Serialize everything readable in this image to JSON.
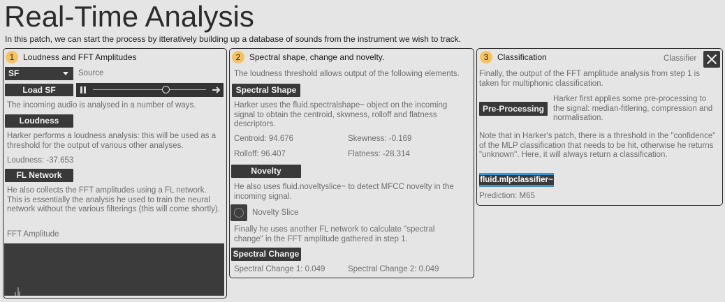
{
  "header": {
    "title": "Real-Time Analysis",
    "subtitle": "In this patch, we can start the process by itteratively building up a database of sounds from the instrument we wish to track."
  },
  "panel1": {
    "number": "1",
    "heading": "Loudness and FFT Amplitudes",
    "source_select": {
      "value": "SF",
      "label": "Source"
    },
    "load_button": "Load SF",
    "player": {
      "icon": "pause-icon",
      "position": 0.65,
      "arrow_icon": "arrow-right-icon"
    },
    "intro_text": "The incoming audio is analysed in a number of ways.",
    "loudness_button": "Loudness",
    "loudness_text": "Harker performs a loudness analysis: this will be used as a threshold for the output of various other analyses.",
    "loudness_readout": "Loudness: -37.653",
    "fl_button": "FL Network",
    "fl_text": "He also collects the FFT amplitudes using a FL network. This is essentially the analysis he used to train the neural network without the various filterings (this will come shortly).",
    "fft_label": "FFT Amplitude"
  },
  "panel2": {
    "number": "2",
    "heading": "Spectral shape, change and novelty.",
    "intro_text": "The loudness threshold allows output of the following elements.",
    "shape_button": "Spectral Shape",
    "shape_text": "Harker uses the fluid.spectralshape~ object on the incoming signal to obtain the centroid, skwness, rolloff and flatness descriptors.",
    "centroid": "Centroid: 94.676",
    "skewness": "Skewness: -0.169",
    "rolloff": "Rolloff: 96.407",
    "flatness": "Flatness: -28.314",
    "novelty_button": "Novelty",
    "novelty_text": "He also uses fluid.noveltyslice~ to detect MFCC novelty in the incoming signal.",
    "novelty_slice_label": "Novelty Slice",
    "change_text": "Finally he uses another FL network to calculate \"spectral change\" in the FFT amplitude gathered in step 1.",
    "change_button": "Spectral Change",
    "change_1": "Spectral Change 1: 0.049",
    "change_2": "Spectral Change 2: 0.049"
  },
  "panel3": {
    "number": "3",
    "heading": "Classification",
    "classifier_label": "Classifier",
    "intro_text": "Finally, the output of the FFT amplitude analysis from step 1 is taken for multiphonic classification.",
    "preprocess_button": "Pre-Processing",
    "preprocess_text": "Harker first applies some pre-processing to the signal: median-fitlering, compression and normalisation.",
    "note_text": "Note that in Harker's patch, there is a threshold in the \"confidence\" of the MLP classification that needs to be hit, otherwise he returns \"unknown\". Here, it will always return a classification.",
    "mlp_button": "fluid.mlpclassifier~",
    "prediction": "Prediction: M65"
  },
  "colors": {
    "background": "#e5e5e5",
    "dark_control": "#393939",
    "badge": "#f7c35f",
    "accent_blue": "#3b95d2",
    "muted_text": "#6e6e6e"
  }
}
